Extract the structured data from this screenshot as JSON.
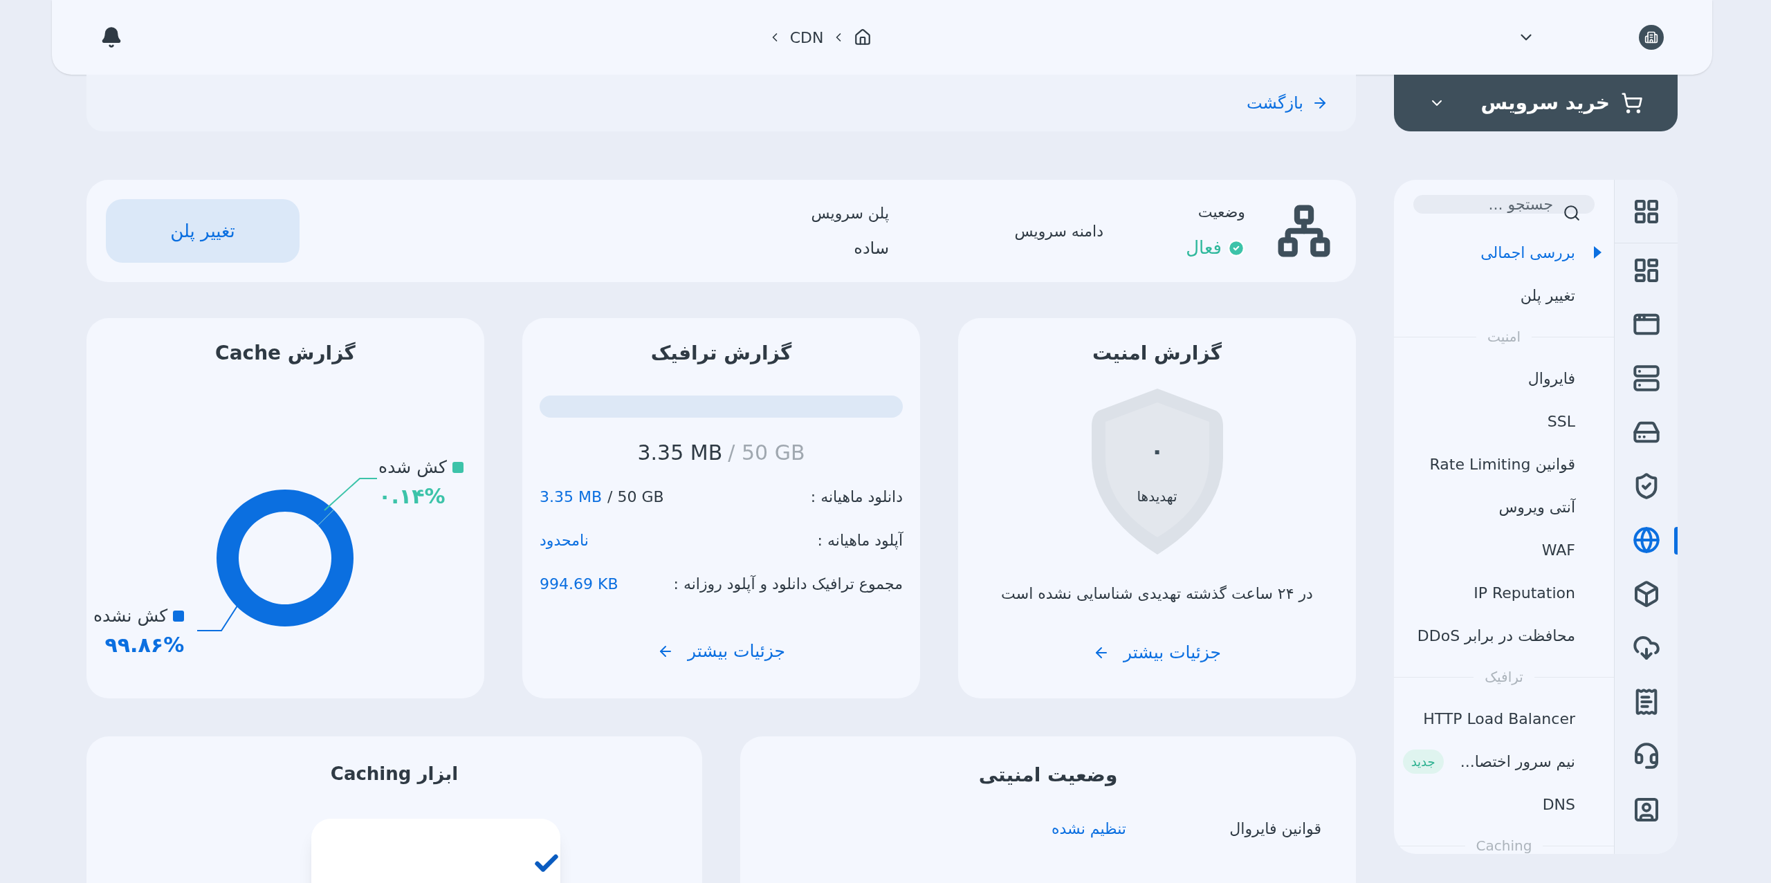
{
  "top_bar": {
    "breadcrumb": [
      "CDN"
    ]
  },
  "buy_button": {
    "label": "خرید سرویس"
  },
  "back_link": "بازگشت",
  "service": {
    "fields": [
      {
        "label": "وضعیت",
        "value": "فعال",
        "kind": "status",
        "active": true
      },
      {
        "label": "دامنه سرویس",
        "kind": "text"
      },
      {
        "label": "پلن سرویس",
        "value": "ساده",
        "kind": "text"
      }
    ],
    "change_plan": "تغییر پلن"
  },
  "security_report": {
    "title": "گزارش امنیت",
    "threat_count": "۰",
    "threat_label": "تهدیدها",
    "message": "در ۲۴ ساعت گذشته تهدیدی شناسایی نشده است",
    "details": "جزئیات بیشتر"
  },
  "traffic_report": {
    "title": "گزارش ترافیک",
    "level": 0,
    "used": "3.35 MB",
    "total": "/ 50 GB",
    "rows": [
      {
        "label": "دانلود ماهیانه :",
        "value": "3.35 MB",
        "total": "/ 50 GB"
      },
      {
        "label": "آپلود ماهیانه :",
        "value": "نامحدود"
      },
      {
        "label": "مجموع ترافیک دانلود و آپلود روزانه :",
        "value": "994.69 KB"
      }
    ],
    "details": "جزئیات بیشتر"
  },
  "cache_report": {
    "title": "گزارش Cache",
    "slices": [
      {
        "color": "#3cc3a9"
      },
      {
        "color": "#0b6fe0"
      }
    ],
    "chart_data": {
      "type": "donut",
      "categories": [
        "کش شده",
        "کش نشده"
      ],
      "series": [
        {
          "values": [
            0.14,
            99.86
          ]
        }
      ],
      "value_labels": [
        "۰.۱۴%",
        "۹۹.۸۶%"
      ],
      "legend": "top left"
    }
  },
  "security_status": {
    "title": "وضعیت امنیتی",
    "rows": [
      {
        "label": "قوانین فایروال",
        "value": "تنظیم نشده"
      }
    ]
  },
  "caching_tools": {
    "title": "ابزار Caching"
  },
  "sidebar": {
    "search_placeholder": "جستجو ...",
    "items": [
      {
        "kind": "link",
        "label": "بررسی اجمالی",
        "selected": true
      },
      {
        "kind": "link",
        "label": "تغییر پلن",
        "selected": false
      },
      {
        "kind": "section",
        "label": "امنیت"
      },
      {
        "kind": "link",
        "label": "فایروال",
        "selected": false
      },
      {
        "kind": "link",
        "label": "SSL",
        "selected": false
      },
      {
        "kind": "link",
        "label": "قوانین Rate Limiting",
        "selected": false
      },
      {
        "kind": "link",
        "label": "آنتی ویروس",
        "selected": false
      },
      {
        "kind": "link",
        "label": "WAF",
        "selected": false
      },
      {
        "kind": "link",
        "label": "IP Reputation",
        "selected": false
      },
      {
        "kind": "link",
        "label": "محافظت در برابر DDoS",
        "selected": false
      },
      {
        "kind": "section",
        "label": "ترافیک"
      },
      {
        "kind": "link",
        "label": "HTTP Load Balancer",
        "selected": false
      },
      {
        "kind": "link",
        "label": "نیم سرور اختصا...",
        "badge": "جدید",
        "selected": false
      },
      {
        "kind": "link",
        "label": "DNS",
        "selected": false
      },
      {
        "kind": "section",
        "label": "Caching"
      }
    ]
  },
  "rail": [
    {
      "kind": "apps",
      "selected": false
    },
    {
      "kind": "dashboard",
      "selected": false
    },
    {
      "kind": "web",
      "selected": false
    },
    {
      "kind": "server",
      "selected": false
    },
    {
      "kind": "drive",
      "selected": false
    },
    {
      "kind": "shield",
      "selected": false
    },
    {
      "kind": "globe",
      "selected": true
    },
    {
      "kind": "box",
      "selected": false
    },
    {
      "kind": "transfer",
      "selected": false
    },
    {
      "kind": "receipt",
      "selected": false
    },
    {
      "kind": "support",
      "selected": false
    },
    {
      "kind": "user",
      "selected": false
    }
  ]
}
